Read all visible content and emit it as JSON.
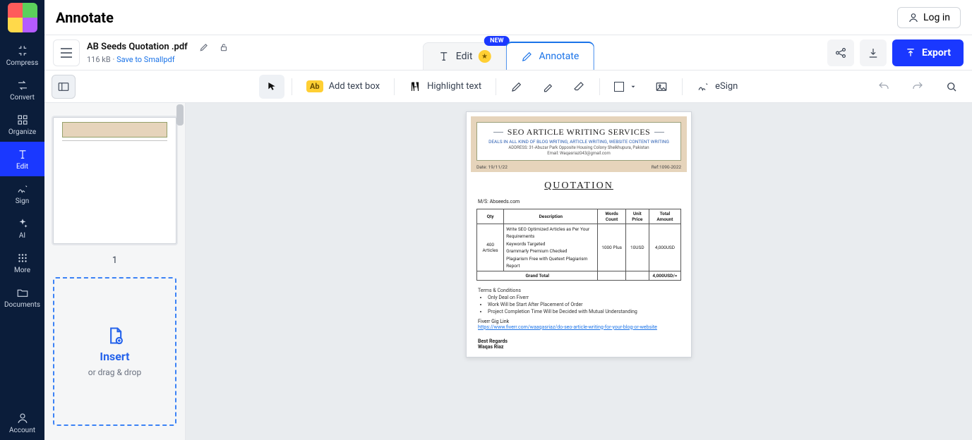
{
  "app": {
    "title": "Annotate",
    "login": "Log in"
  },
  "rail": {
    "compress": "Compress",
    "convert": "Convert",
    "organize": "Organize",
    "edit": "Edit",
    "sign": "Sign",
    "ai": "AI",
    "more": "More",
    "documents": "Documents",
    "account": "Account"
  },
  "file": {
    "name": "AB Seeds Quotation .pdf",
    "size": "116 kB",
    "dot": "·",
    "save_link": "Save to Smallpdf"
  },
  "tabs": {
    "edit": "Edit",
    "annotate": "Annotate",
    "new_badge": "NEW"
  },
  "actions": {
    "export": "Export"
  },
  "toolbar": {
    "add_text": "Add text box",
    "highlight": "Highlight text",
    "esign": "eSign"
  },
  "thumb": {
    "page_number": "1",
    "insert_title": "Insert",
    "insert_sub": "or drag & drop"
  },
  "doc": {
    "company": "SEO ARTICLE WRITING SERVICES",
    "tagline": "DEALS IN ALL KIND OF BLOG WRITING, ARTICLE WRITING, WEBSITE CONTENT WRITING",
    "address": "ADDRESS: 31-Abuzar Park Opposite Housing Colony Sheikhupura, Pakistan",
    "email": "Email: Waqasriaz043@gmail.com",
    "date_label": "Date: 19/11/22",
    "ref_label": "Ref:1090-2022",
    "title": "QUOTATION",
    "client": "M/S: Abseeds.com",
    "headers": {
      "qty": "Qty",
      "desc": "Description",
      "words": "Words Count",
      "unit": "Unit Price",
      "total": "Total Amount"
    },
    "row": {
      "qty": "400 Articles",
      "d1": "Write SEO Optimized Articles as Per Your Requirements",
      "d2": "Keywords Targeted",
      "d3": "Grammarly Premium Checked",
      "d4": "Plagiarism Free with Quetext Plagiarism Report",
      "words": "1000 Plus",
      "unit": "10USD",
      "total": "4,000USD"
    },
    "grand_label": "Grand Total",
    "grand_total": "4,000USD/=",
    "terms_title": "Terms & Conditions",
    "t1": "Only Deal on Fiverr",
    "t2": "Work Will be Start After Placement of Order",
    "t3": "Project Completion Time Will be Decided with Mutual Understanding",
    "gig_label": "Fiverr Gig Link",
    "gig_url": "https://www.fiverr.com/waaqasriaz/do-seo-article-writing-for-your-blog-or-website",
    "regards": "Best Regards",
    "author": "Waqas Riaz"
  }
}
